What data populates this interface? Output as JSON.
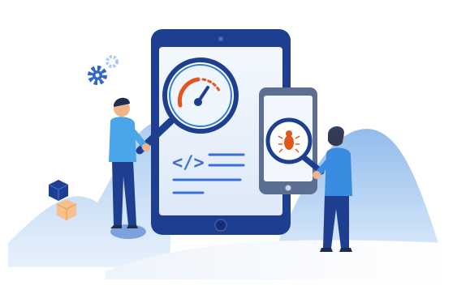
{
  "illustration": {
    "code_symbol": "</>",
    "colors": {
      "primary": "#1e3f8f",
      "accent_blue": "#2f7de1",
      "light_blue": "#cfe3f7",
      "warning": "#e2561c",
      "skin": "#f2b38b",
      "background_hill": "#a9c9ee"
    },
    "icons": [
      "gear-icon",
      "speedometer-icon",
      "magnifier-icon",
      "bug-icon",
      "cube-icon",
      "code-icon"
    ]
  }
}
